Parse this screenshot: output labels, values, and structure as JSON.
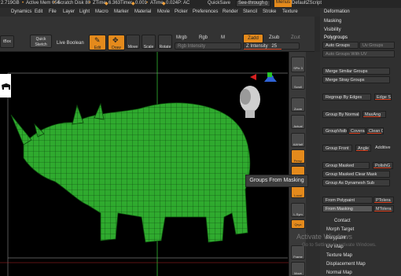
{
  "status": {
    "mem": "2.719GB",
    "active_mem": "Active Mem 654",
    "scratch": "Scratch Disk 80",
    "ztime": "ZTime",
    "ztime_val": "6.363",
    "timer": "Timer",
    "timer_val": "0.001",
    "atime": "ATime",
    "atime_val": "0.024",
    "tail": "P: AC",
    "quicksave": "QuickSave",
    "seethrough_label": "See-through",
    "seethrough_val": "0",
    "menus": "Menus",
    "script": "DefaultZScript"
  },
  "menu": {
    "items": [
      "Document",
      "Draw",
      "Dynamics",
      "Edit",
      "File",
      "Layer",
      "Light",
      "Macro",
      "Marker",
      "Material",
      "Movie",
      "Picker",
      "Preferences",
      "Render",
      "Stencil",
      "Stroke",
      "Texture"
    ],
    "visible": [
      "Dynamics",
      "Edit",
      "File",
      "Layer",
      "Light",
      "Macro",
      "Marker",
      "Material",
      "Movie",
      "Picker",
      "Preferences",
      "Render",
      "Stencil",
      "Stroke",
      "Texture"
    ],
    "help": "elp"
  },
  "toolbar": {
    "lightbox": "tBox",
    "quick_sketch": "Quick Sketch",
    "live_boolean": "Live Boolean",
    "edit": "Edit",
    "draw": "Draw",
    "move": "Move",
    "scale": "Scale",
    "rotate": "Rotate",
    "mrgb": "Mrgb",
    "rgb": "Rgb",
    "m": "M",
    "rgb_intensity": "Rgb Intensity",
    "zadd": "Zadd",
    "zsub": "Zsub",
    "zcut": "Zcut",
    "z_intensity_label": "Z Intensity",
    "z_intensity_val": "25"
  },
  "shelf": {
    "spix_label": "SPix",
    "spix_val": "3",
    "scroll": "Scroll",
    "zoom": "Zoom",
    "actual": "Actual",
    "aahalf": "AAHalf",
    "persp": "Persp",
    "floor": "Floor",
    "local": "Local",
    "lsym": "L.Sym",
    "xyz": "Qxyz",
    "frame": "Frame",
    "move": "Move"
  },
  "palette": {
    "header_items": [
      "Deformation",
      "Masking",
      "Visibility",
      "Polygroups"
    ],
    "auto_groups": "Auto Groups",
    "uv_groups": "Uv Groups",
    "auto_groups_uv": "Auto Groups With UV",
    "merge_similar": "Merge Similar Groups",
    "merge_stray": "Merge Stray Groups",
    "regroup_edges": "Regroup By Edges",
    "edge_se": "Edge Se",
    "group_by_normals": "Group By Normals",
    "max_ang": "MaxAng",
    "group_visible": "GroupVisible",
    "coverage": "Coverage",
    "clean": "Clean",
    "clean_val": "0",
    "group_front": "Group Front",
    "angle": "Angle",
    "additive": "Additive",
    "group_masked": "Group Masked",
    "polish": "PolishG",
    "group_masked_clear": "Group Masked Clear Mask",
    "group_as_dynamesh": "Group As Dynamesh Sub",
    "from_polypaint": "From Polypaint",
    "ptolera": "PTolera",
    "from_masking": "From Masking",
    "mtolera": "MTolera",
    "contact": "Contact",
    "morph_target": "Morph Target",
    "polypaint": "Polypaint",
    "uv_map": "UV Map",
    "texture_map": "Texture Map",
    "displacement_map": "Displacement Map",
    "normal_map": "Normal Map"
  },
  "tooltip": "Groups From Masking",
  "watermark": {
    "line1": "Activate Windows",
    "line2": "Go to Settings to activate Windows."
  },
  "colors": {
    "accent": "#e48a1c",
    "mesh": "#3fc43c",
    "slider_red": "#d9401e"
  }
}
